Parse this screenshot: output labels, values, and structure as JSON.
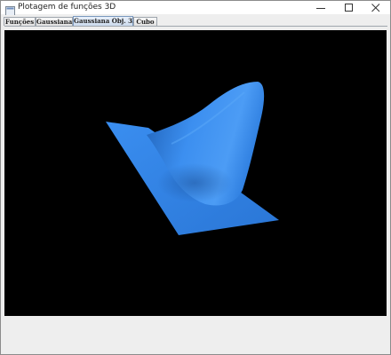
{
  "window": {
    "title": "Plotagem de funções 3D",
    "icon": "java-app-icon"
  },
  "tabs": [
    {
      "label": "Funções",
      "active": false
    },
    {
      "label": "Gaussiana",
      "active": false
    },
    {
      "label": "Gaussiana Obj. 3D",
      "active": true
    },
    {
      "label": "Cubo",
      "active": false
    }
  ],
  "scene": {
    "description_icon": "gaussian-surface",
    "background_color": "#000000",
    "surface_color": "#2f7fe0"
  }
}
